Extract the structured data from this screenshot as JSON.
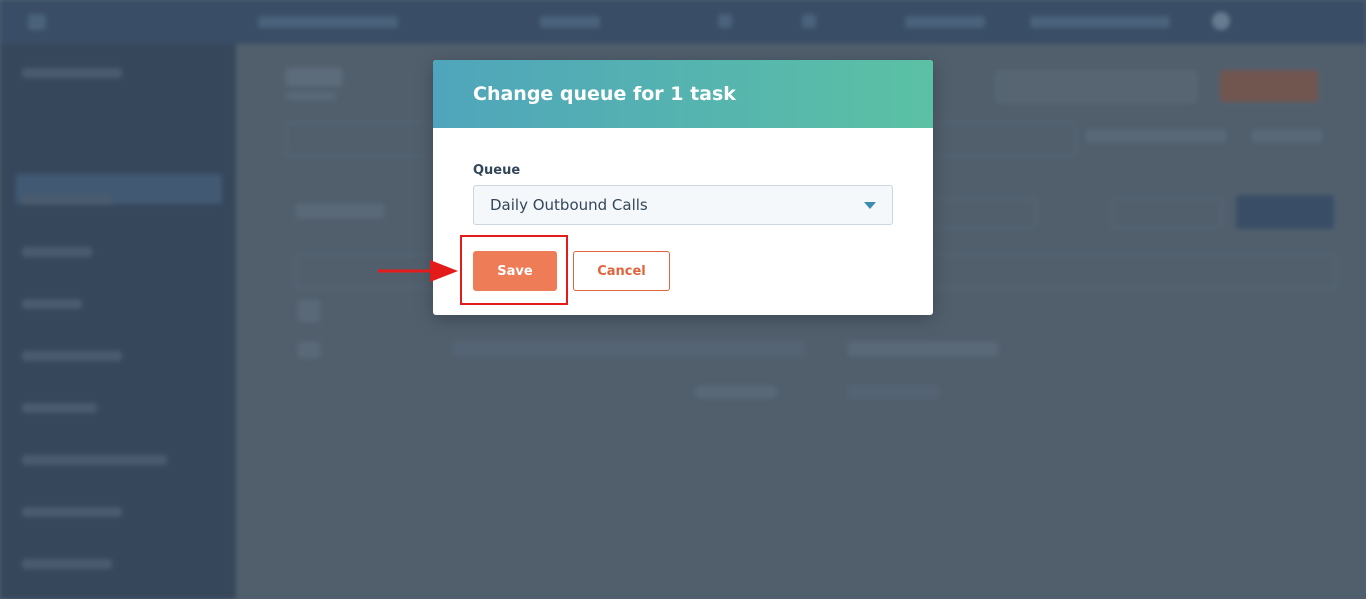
{
  "modal": {
    "title": "Change queue for 1 task",
    "queue_label": "Queue",
    "queue_selected": "Daily Outbound Calls",
    "save_label": "Save",
    "cancel_label": "Cancel"
  },
  "colors": {
    "header_gradient_start": "#4fa5bb",
    "header_gradient_end": "#5bc1a4",
    "primary_button": "#ee7c57",
    "secondary_button_text": "#e0643b",
    "annotation": "#e41b1b"
  },
  "icons": {
    "dropdown": "chevron-down-icon",
    "annotation_arrow": "arrow-right-icon"
  }
}
